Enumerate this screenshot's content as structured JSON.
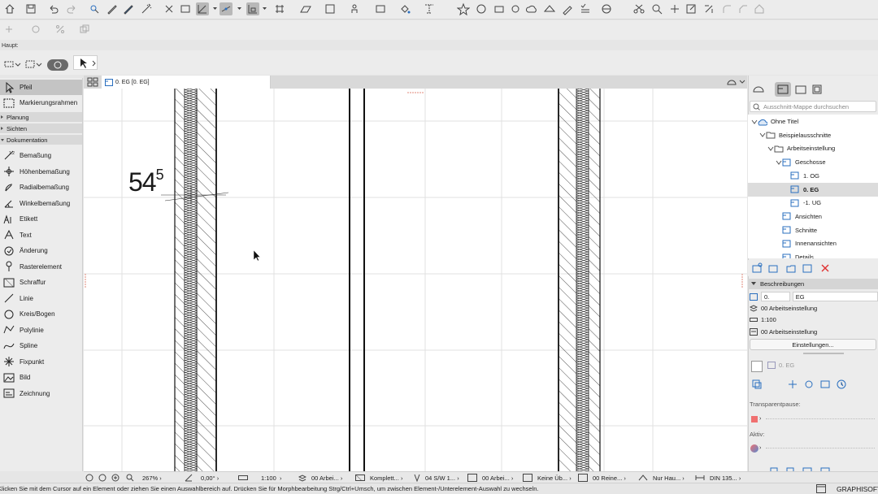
{
  "toolbar3": {
    "arrow_tool": "pointer"
  },
  "haupt_label": "Haupt:",
  "toolbox": {
    "items": [
      {
        "label": "Pfeil",
        "icon": "arrow-pointer-icon"
      },
      {
        "label": "Markierungsrahmen",
        "icon": "marquee-icon"
      }
    ],
    "sections": [
      {
        "label": "Planung"
      },
      {
        "label": "Sichten"
      },
      {
        "label": "Dokumentation"
      }
    ],
    "doc_items": [
      {
        "label": "Bemaßung",
        "icon": "dimension-icon"
      },
      {
        "label": "Höhenbemaßung",
        "icon": "level-dimension-icon"
      },
      {
        "label": "Radialbemaßung",
        "icon": "radial-dimension-icon"
      },
      {
        "label": "Winkelbemaßung",
        "icon": "angle-dimension-icon"
      },
      {
        "label": "Etikett",
        "icon": "label-icon"
      },
      {
        "label": "Text",
        "icon": "text-icon"
      },
      {
        "label": "Änderung",
        "icon": "revision-cloud-icon"
      },
      {
        "label": "Rasterelement",
        "icon": "grid-element-icon"
      },
      {
        "label": "Schraffur",
        "icon": "fill-icon"
      },
      {
        "label": "Linie",
        "icon": "line-icon"
      },
      {
        "label": "Kreis/Bogen",
        "icon": "arc-icon"
      },
      {
        "label": "Polylinie",
        "icon": "polyline-icon"
      },
      {
        "label": "Spline",
        "icon": "spline-icon"
      },
      {
        "label": "Fixpunkt",
        "icon": "hotspot-icon"
      },
      {
        "label": "Bild",
        "icon": "figure-icon"
      },
      {
        "label": "Zeichnung",
        "icon": "drawing-icon"
      }
    ]
  },
  "tab": {
    "label": "0. EG [0. EG]"
  },
  "canvas": {
    "dimension_main": "54",
    "dimension_sup": "5"
  },
  "rightpanel": {
    "search_placeholder": "Ausschnitt-Mappe durchsuchen",
    "tree": [
      {
        "label": "Ohne Titel"
      },
      {
        "label": "Beispielausschnitte"
      },
      {
        "label": "Arbeitseinstellung"
      },
      {
        "label": "Geschosse"
      },
      {
        "label": "1. OG"
      },
      {
        "label": "0. EG"
      },
      {
        "label": "-1. UG"
      },
      {
        "label": "Ansichten"
      },
      {
        "label": "Schnitte"
      },
      {
        "label": "Innenansichten"
      },
      {
        "label": "Details"
      }
    ],
    "descriptions_header": "Beschreibungen",
    "id_field": "0.",
    "name_field": "EG",
    "layer_set": "00 Arbeitseinstellung",
    "scale": "1:100",
    "model_set": "00 Arbeitseinstellung",
    "settings_button": "Einstellungen...",
    "nav_label": "0. EG",
    "transparent_label": "Transparentpause:",
    "active_label": "Aktiv:"
  },
  "bottombar": {
    "zoom": "267%",
    "angle": "0,00°",
    "scale": "1:100",
    "layer": "00 Arbei...",
    "structure": "Komplett...",
    "pen": "04 S/W 1...",
    "model": "00 Arbei...",
    "override": "Keine Üb...",
    "renovation": "00 Reine...",
    "dim": "Nur Hau...",
    "din": "DIN 135..."
  },
  "statusbar": {
    "message": "Klicken Sie mit dem Cursor auf ein Element oder ziehen Sie einen Auswahlbereich auf. Drücken Sie für Morphbearbeitung Strg/Ctrl+Umsch, um zwischen Element-/Unterelement-Auswahl zu wechseln.",
    "brand": "GRAPHISOFT"
  }
}
